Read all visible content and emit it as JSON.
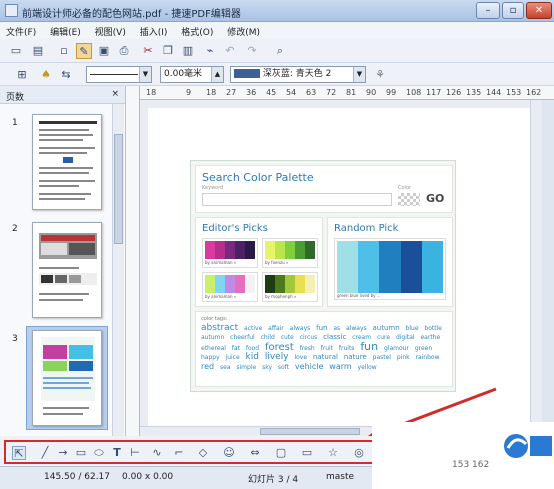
{
  "window": {
    "title": "前端设计师必备的配色网站.pdf - 捷速PDF编辑器",
    "minimize": "–",
    "maximize": "▫",
    "close": "✕"
  },
  "menu": [
    "文件(F)",
    "编辑(E)",
    "视图(V)",
    "插入(I)",
    "格式(O)",
    "修改(M)"
  ],
  "toolbar2": {
    "line_width_value": "0.00毫米",
    "color_value": "深灰蓝: 青天色 2"
  },
  "sidepanel": {
    "title": "页数",
    "close": "×",
    "pages": [
      "1",
      "2",
      "3"
    ]
  },
  "ruler": [
    "18",
    "9",
    "9",
    "18",
    "27",
    "36",
    "45",
    "54",
    "63",
    "72",
    "81",
    "90",
    "99",
    "108",
    "117",
    "126",
    "135",
    "144",
    "153",
    "162"
  ],
  "document": {
    "search_title": "Search Color Palette",
    "keyword_label": "Keyword",
    "color_label": "Color",
    "go": "GO",
    "editors_title": "Editor's Picks",
    "random_title": "Random Pick",
    "picks": [
      {
        "by": "by animaman »",
        "colors": [
          "#d93aa0",
          "#b52f8a",
          "#7a2a7e",
          "#4d2166",
          "#2b1a47"
        ]
      },
      {
        "by": "by foenzu »",
        "colors": [
          "#e7f46a",
          "#b8e64b",
          "#7fcf3e",
          "#4a9c33",
          "#2f6a2a"
        ]
      },
      {
        "by": "by animaman »",
        "colors": [
          "#c9f06a",
          "#7fd6ee",
          "#c08ae6",
          "#e56fbc",
          "#f2f2f2"
        ]
      },
      {
        "by": "by mophenph »",
        "colors": [
          "#1f3d14",
          "#4f7a1c",
          "#9fc93a",
          "#e8e04f",
          "#f6efb2"
        ]
      }
    ],
    "random_colors": [
      "#9fe0e6",
      "#4fbfe8",
      "#1f7fbf",
      "#1b4f9a",
      "#3ab3e0"
    ],
    "random_by": "green blue lived by ...",
    "tags_label": "color tags:",
    "tags": [
      "abstract",
      "active",
      "affair",
      "always",
      "fun",
      "as",
      "always",
      "autumn",
      "blue",
      "bottle",
      "autumn",
      "cheerful",
      "child",
      "cute",
      "circus",
      "classic",
      "cream",
      "cure",
      "digital",
      "earthe",
      "ethereal",
      "fat",
      "food",
      "forest",
      "fresh",
      "fruit",
      "fruits",
      "fun",
      "glamour",
      "green",
      "happy",
      "juice",
      "kid",
      "lively",
      "love",
      "natural",
      "nature",
      "pastel",
      "pink",
      "rainbow",
      "red",
      "sea",
      "simple",
      "sky",
      "soft",
      "vehicle",
      "warm",
      "yellow"
    ]
  },
  "status": {
    "coords": "145.50 / 62.17",
    "size": "0.00 x 0.00",
    "slide": "幻灯片 3 / 4",
    "master": "maste",
    "ruler_tail": "153 162"
  },
  "colors": {
    "accent": "#2f7ab7",
    "highlight_box": "#d42a2a"
  }
}
